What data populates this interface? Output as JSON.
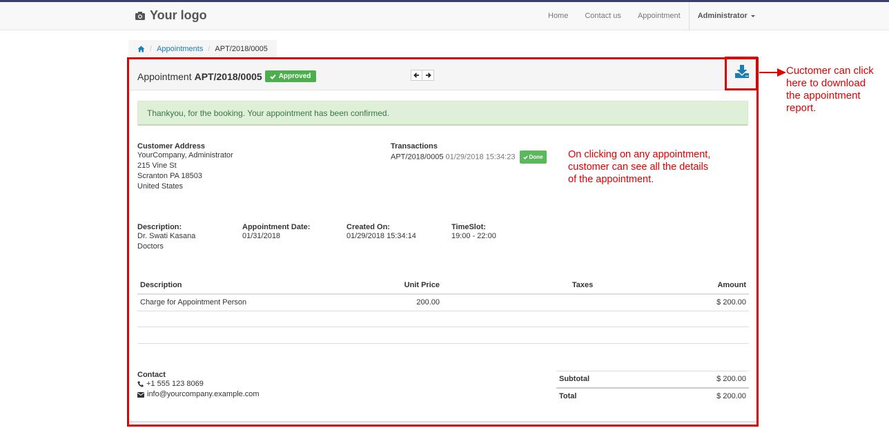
{
  "navbar": {
    "logo_text": "Your logo",
    "items": [
      "Home",
      "Contact us",
      "Appointment"
    ],
    "user": "Administrator"
  },
  "breadcrumb": {
    "home_icon": "home-icon",
    "appointments": "Appointments",
    "current": "APT/2018/0005"
  },
  "header": {
    "label": "Appointment",
    "number": "APT/2018/0005",
    "status": "Approved",
    "download_icon": "download-icon"
  },
  "alert": {
    "message": "Thankyou, for the booking. Your appointment has been confirmed."
  },
  "customer": {
    "title": "Customer Address",
    "lines": [
      "YourCompany, Administrator",
      "215 Vine St",
      "Scranton PA 18503",
      "United States"
    ]
  },
  "transactions": {
    "title": "Transactions",
    "ref": "APT/2018/0005",
    "date": "01/29/2018 15:34:23",
    "status": "Done"
  },
  "details": {
    "description_label": "Description:",
    "description_lines": [
      "Dr. Swati Kasana",
      "Doctors"
    ],
    "appointment_date_label": "Appointment Date:",
    "appointment_date": "01/31/2018",
    "created_on_label": "Created On:",
    "created_on": "01/29/2018 15:34:14",
    "timeslot_label": "TimeSlot:",
    "timeslot": "19:00 - 22:00"
  },
  "lines_table": {
    "headers": [
      "Description",
      "Unit Price",
      "Taxes",
      "Amount"
    ],
    "rows": [
      {
        "description": "Charge for Appointment Person",
        "unit_price": "200.00",
        "taxes": "",
        "amount": "$ 200.00"
      }
    ]
  },
  "contact": {
    "title": "Contact",
    "phone": "+1 555 123 8069",
    "email": "info@yourcompany.example.com"
  },
  "totals": {
    "subtotal_label": "Subtotal",
    "subtotal": "$ 200.00",
    "total_label": "Total",
    "total": "$ 200.00"
  },
  "annotations": {
    "download_note": [
      "Cuctomer can click",
      "here to download",
      "the appointment",
      "report."
    ],
    "details_note": [
      "On clicking on any appointment,",
      "customer can see all the details",
      "of the appointment."
    ]
  },
  "colors": {
    "annotation_red": "#e00000",
    "approved_green": "#4cae4c",
    "link_blue": "#1a7db6"
  }
}
